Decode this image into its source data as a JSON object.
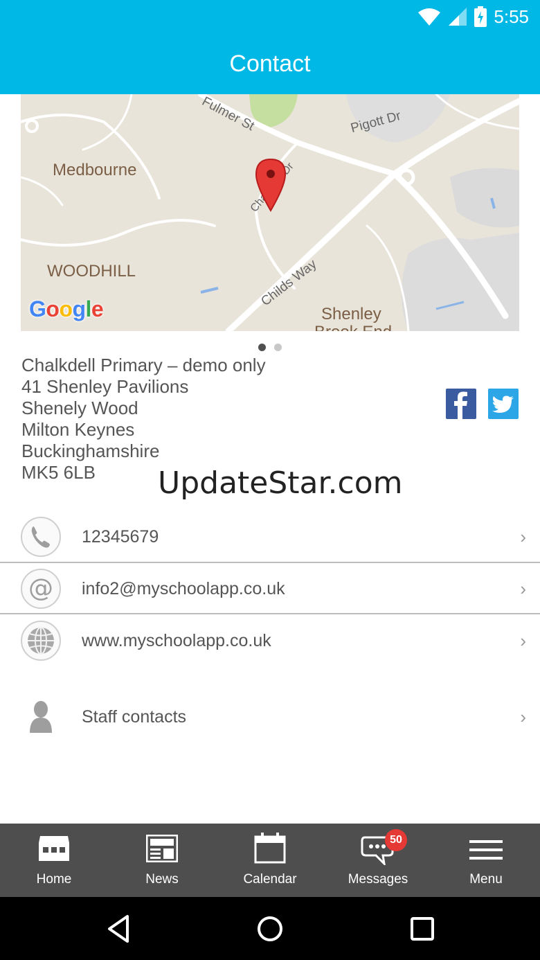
{
  "status_bar": {
    "time": "5:55",
    "icons": [
      "wifi-icon",
      "cellular-signal-icon",
      "battery-charging-icon"
    ]
  },
  "header": {
    "title": "Contact"
  },
  "map": {
    "places": [
      "Medbourne",
      "WOODHILL",
      "Shenley",
      "Brook End"
    ],
    "streets": [
      "Fulmer St",
      "Pigott Dr",
      "Chalkdell Dr",
      "Childs Way"
    ],
    "logo_text": "Google",
    "pages": 2,
    "current_page": 1
  },
  "address": {
    "lines": [
      "Chalkdell Primary – demo only",
      "41 Shenley Pavilions",
      "Shenely Wood",
      "Milton Keynes",
      "Buckinghamshire",
      "MK5 6LB"
    ]
  },
  "social": [
    "facebook-icon",
    "twitter-icon"
  ],
  "watermark": "UpdateStar.com",
  "contacts": [
    {
      "icon": "phone-icon",
      "label": "12345679"
    },
    {
      "icon": "at-sign-icon",
      "label": "info2@myschoolapp.co.uk"
    },
    {
      "icon": "globe-icon",
      "label": "www.myschoolapp.co.uk"
    },
    {
      "icon": "person-icon",
      "label": "Staff contacts"
    }
  ],
  "tabs": [
    {
      "label": "Home",
      "icon": "home-icon"
    },
    {
      "label": "News",
      "icon": "news-icon"
    },
    {
      "label": "Calendar",
      "icon": "calendar-icon"
    },
    {
      "label": "Messages",
      "icon": "messages-icon",
      "badge": "50"
    },
    {
      "label": "Menu",
      "icon": "menu-icon"
    }
  ],
  "colors": {
    "header": "#00b8e6",
    "tab_bar": "#4e4e4e",
    "badge": "#e53935",
    "facebook": "#3a5ba0",
    "twitter": "#2ca6e7"
  }
}
